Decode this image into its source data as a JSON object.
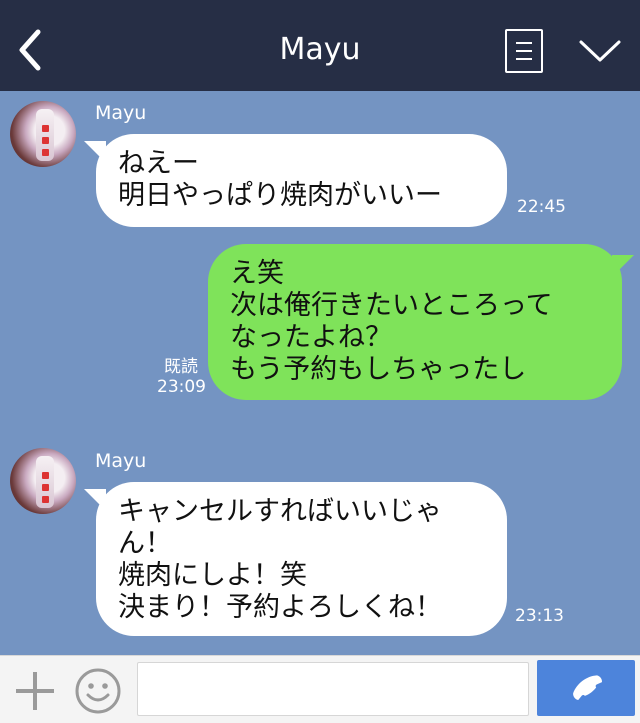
{
  "header": {
    "title": "Mayu",
    "icons": {
      "back": "chevron-left-icon",
      "menu": "menu-list-icon",
      "collapse": "chevron-down-icon"
    }
  },
  "messages": [
    {
      "direction": "incoming",
      "sender": "Mayu",
      "lines": [
        "ねえー",
        "明日やっぱり焼肉がいいー"
      ],
      "time": "22:45"
    },
    {
      "direction": "outgoing",
      "lines": [
        "え笑",
        "次は俺行きたいところって",
        "なったよね？",
        "もう予約もしちゃったし"
      ],
      "read": "既読",
      "time": "23:09"
    },
    {
      "direction": "incoming",
      "sender": "Mayu",
      "lines": [
        "キャンセルすればいいじゃ",
        "ん！",
        "焼肉にしよ！笑",
        "決まり！予約よろしくね！"
      ],
      "time": "23:13"
    }
  ],
  "input_bar": {
    "icons": {
      "add": "plus-icon",
      "emoji": "smiley-icon",
      "call": "phone-icon"
    },
    "message_value": "",
    "colors": {
      "call_button": "#4d84db"
    }
  },
  "colors": {
    "header": "#262e45",
    "background": "#7494c2",
    "outgoing_bubble": "#7fe35a",
    "incoming_bubble": "#ffffff"
  }
}
